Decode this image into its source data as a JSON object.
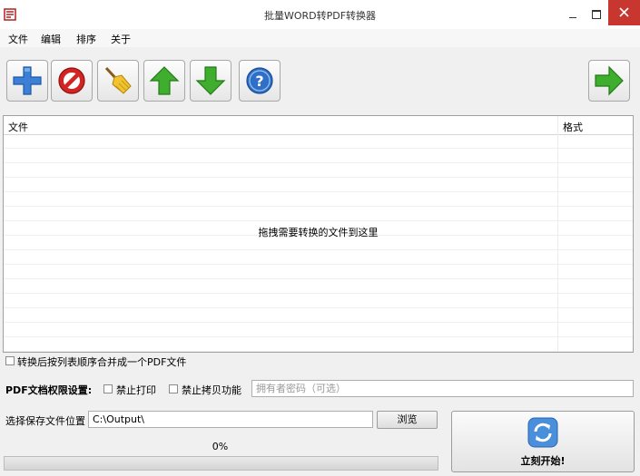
{
  "window": {
    "title": "批量WORD转PDF转换器"
  },
  "menu": {
    "items": [
      "文件",
      "编辑",
      "排序",
      "关于"
    ]
  },
  "toolbar": {
    "buttons": [
      {
        "icon": "add-icon"
      },
      {
        "icon": "remove-icon"
      },
      {
        "icon": "clear-broom-icon"
      },
      {
        "icon": "move-up-icon"
      },
      {
        "icon": "move-down-icon"
      },
      {
        "icon": "help-icon"
      },
      {
        "icon": "next-arrow-icon"
      }
    ]
  },
  "file_list": {
    "columns": [
      "文件",
      "格式"
    ],
    "drop_hint": "拖拽需要转换的文件到这里"
  },
  "options": {
    "merge_label": "转换后按列表顺序合并成一个PDF文件",
    "permissions_label": "PDF文档权限设置:",
    "no_print_label": "禁止打印",
    "no_copy_label": "禁止拷贝功能",
    "owner_password_placeholder": "拥有者密码（可选）"
  },
  "output": {
    "label": "选择保存文件位置",
    "path": "C:\\Output\\",
    "browse_label": "浏览"
  },
  "progress": {
    "text": "0%",
    "value": 0
  },
  "start": {
    "label": "立刻开始!"
  },
  "colors": {
    "close_button": "#c7372f",
    "add_blue": "#3d7fd4",
    "remove_red": "#d32424",
    "arrow_green": "#3fae2f"
  }
}
